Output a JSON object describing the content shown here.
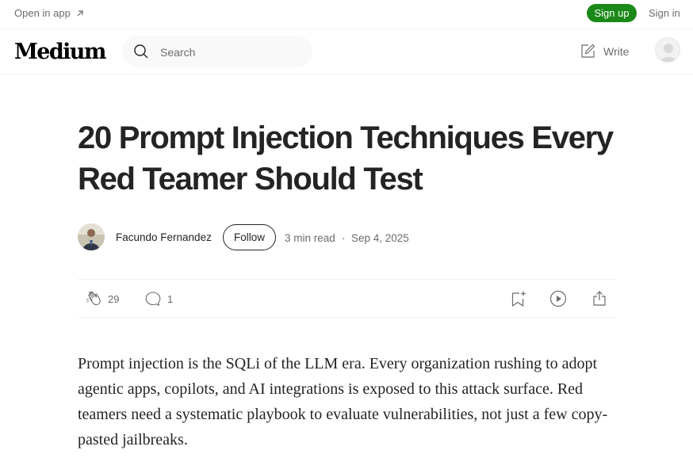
{
  "topbar": {
    "open_in_app": "Open in app",
    "sign_up": "Sign up",
    "sign_in": "Sign in"
  },
  "nav": {
    "logo": "Medium",
    "search_placeholder": "Search",
    "write": "Write"
  },
  "article": {
    "title": "20 Prompt Injection Techniques Every Red Teamer Should Test",
    "author": "Facundo Fernandez",
    "follow": "Follow",
    "read_time": "3 min read",
    "separator": "·",
    "date": "Sep 4, 2025",
    "claps": "29",
    "responses": "1",
    "body": "Prompt injection is the SQLi of the LLM era. Every organization rushing to adopt agentic apps, copilots, and AI integrations is exposed to this attack surface. Red teamers need a systematic playbook to evaluate vulnerabilities, not just a few copy-pasted jailbreaks."
  },
  "colors": {
    "accent_green": "#1a8917",
    "text": "#242424",
    "muted": "#6b6b6b"
  },
  "icons": {
    "open_in_app": "arrow-up-right-icon",
    "search": "search-icon",
    "write": "write-icon",
    "user": "user-avatar-icon",
    "clap": "clap-icon",
    "response": "speech-bubble-icon",
    "save": "bookmark-add-icon",
    "listen": "play-icon",
    "share": "share-icon"
  }
}
